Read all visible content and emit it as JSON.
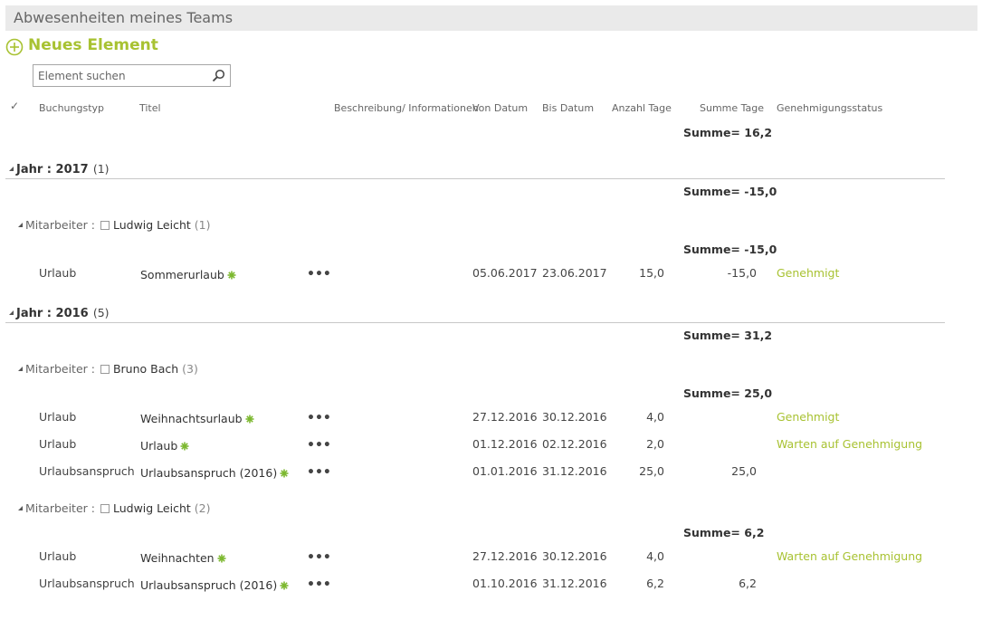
{
  "page": {
    "title": "Abwesenheiten meines Teams",
    "new_item_label": "Neues Element",
    "search_placeholder": "Element suchen"
  },
  "columns": {
    "check": "✓",
    "buchungstyp": "Buchungstyp",
    "titel": "Titel",
    "beschreibung": "Beschreibung/ Informationen",
    "von": "Von Datum",
    "bis": "Bis Datum",
    "anzahl": "Anzahl Tage",
    "summe": "Summe Tage",
    "status": "Genehmigungsstatus"
  },
  "total_sum": "Summe= 16,2",
  "groups": [
    {
      "label": "Jahr : 2017",
      "count": "(1)",
      "sum": "Summe= -15,0",
      "subgroups": [
        {
          "label": "Mitarbeiter :",
          "name": "Ludwig Leicht",
          "count": "(1)",
          "sum": "Summe= -15,0",
          "rows": [
            {
              "typ": "Urlaub",
              "titel": "Sommerurlaub",
              "dots": "•••",
              "von": "05.06.2017",
              "bis": "23.06.2017",
              "anzahl": "15,0",
              "summe": "-15,0",
              "status": "Genehmigt"
            }
          ]
        }
      ]
    },
    {
      "label": "Jahr : 2016",
      "count": "(5)",
      "sum": "Summe= 31,2",
      "subgroups": [
        {
          "label": "Mitarbeiter :",
          "name": "Bruno Bach",
          "count": "(3)",
          "sum": "Summe= 25,0",
          "rows": [
            {
              "typ": "Urlaub",
              "titel": "Weihnachtsurlaub",
              "dots": "•••",
              "von": "27.12.2016",
              "bis": "30.12.2016",
              "anzahl": "4,0",
              "summe": "",
              "status": "Genehmigt"
            },
            {
              "typ": "Urlaub",
              "titel": "Urlaub",
              "dots": "•••",
              "von": "01.12.2016",
              "bis": "02.12.2016",
              "anzahl": "2,0",
              "summe": "",
              "status": "Warten auf Genehmigung"
            },
            {
              "typ": "Urlaubsanspruch",
              "titel": "Urlaubsanspruch (2016)",
              "dots": "•••",
              "von": "01.01.2016",
              "bis": "31.12.2016",
              "anzahl": "25,0",
              "summe": "25,0",
              "status": ""
            }
          ]
        },
        {
          "label": "Mitarbeiter :",
          "name": "Ludwig Leicht",
          "count": "(2)",
          "sum": "Summe= 6,2",
          "rows": [
            {
              "typ": "Urlaub",
              "titel": "Weihnachten",
              "dots": "•••",
              "von": "27.12.2016",
              "bis": "30.12.2016",
              "anzahl": "4,0",
              "summe": "",
              "status": "Warten auf Genehmigung"
            },
            {
              "typ": "Urlaubsanspruch",
              "titel": "Urlaubsanspruch (2016)",
              "dots": "•••",
              "von": "01.10.2016",
              "bis": "31.12.2016",
              "anzahl": "6,2",
              "summe": "6,2",
              "status": ""
            }
          ]
        }
      ]
    }
  ],
  "colors": {
    "accent": "#a8c232",
    "new_star": "#7cb82f"
  }
}
